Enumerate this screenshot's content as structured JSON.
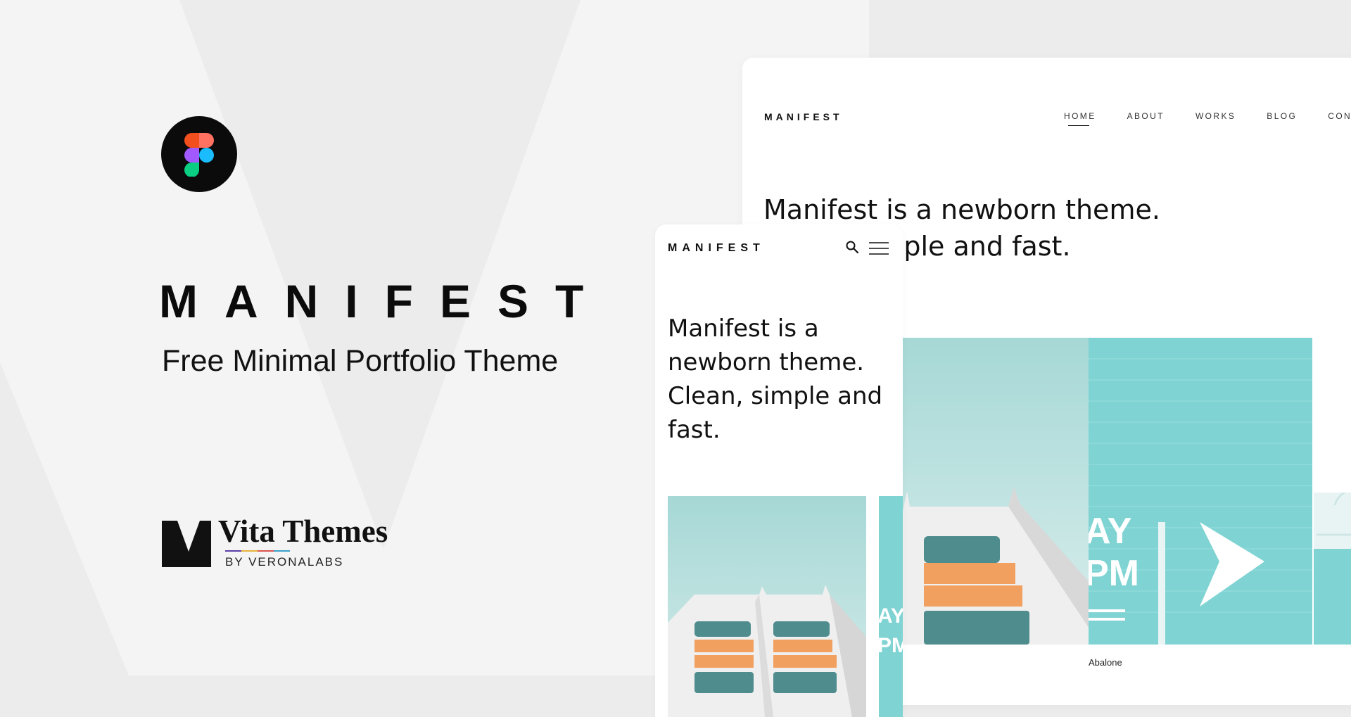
{
  "hero": {
    "title": "MANIFEST",
    "subtitle": "Free Minimal Portfolio Theme",
    "figma_icon": "figma-logo-icon"
  },
  "brand": {
    "name": "Vita Themes",
    "by": "BY VERONALABS",
    "logo_icon": "vita-v-logo-icon",
    "rule_colors": [
      "#5b3fa8",
      "#e8b33a",
      "#d9534f",
      "#3aa0c8"
    ]
  },
  "desktop": {
    "brand": "MANIFEST",
    "nav": [
      {
        "label": "HOME",
        "active": true
      },
      {
        "label": "ABOUT",
        "active": false
      },
      {
        "label": "WORKS",
        "active": false
      },
      {
        "label": "BLOG",
        "active": false
      },
      {
        "label": "CONTACT",
        "active": false
      }
    ],
    "intro": "Manifest is a newborn theme. Clean, simple and fast.",
    "caption": "Abalone",
    "mural_text": [
      "AY",
      "PM"
    ]
  },
  "mobile": {
    "brand": "MANIFEST",
    "search_icon": "search-icon",
    "menu_icon": "hamburger-menu-icon",
    "intro": "Manifest is a newborn theme. Clean, simple and fast.",
    "mural_text": [
      "AY",
      "PM"
    ]
  },
  "colors": {
    "background": "#ececec",
    "sky": "#a9d9d8",
    "wall": "#7fd3d3",
    "orange_panel": "#f2a060",
    "window": "#4f8c8e",
    "ink": "#111111"
  }
}
